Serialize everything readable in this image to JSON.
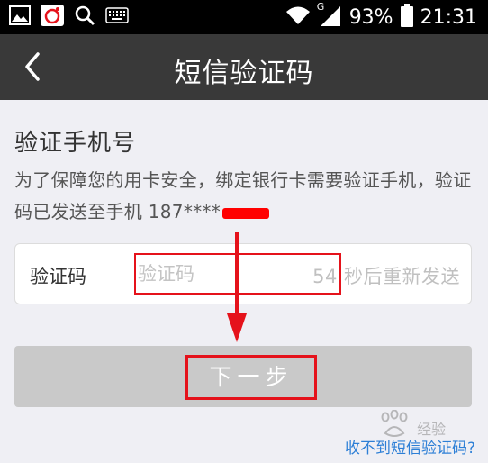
{
  "status_bar": {
    "network_type": "G",
    "battery": "93%",
    "time": "21:31",
    "icons": [
      "image-icon",
      "sina-weibo-icon",
      "search-icon",
      "keyboard-icon",
      "wifi-icon",
      "signal-icon",
      "battery-icon"
    ]
  },
  "nav": {
    "title": "短信验证码",
    "back_icon": "chevron-left-icon"
  },
  "page": {
    "heading": "验证手机号",
    "description": "为了保障您的用卡安全，绑定银行卡需要验证手机，验证码已发送至手机 187****"
  },
  "code_field": {
    "label": "验证码",
    "placeholder": "验证码",
    "value": "",
    "resend_text": "54 秒后重新发送"
  },
  "next_button": {
    "label": "下一步"
  },
  "help_link": {
    "label": "收不到短信验证码?"
  },
  "watermark": {
    "text": "经验"
  },
  "colors": {
    "nav_bg": "#393939",
    "annotation_red": "#e5121b",
    "link_blue": "#2d7fd6",
    "button_disabled": "#c9c9c9",
    "page_bg": "#efeff4"
  }
}
